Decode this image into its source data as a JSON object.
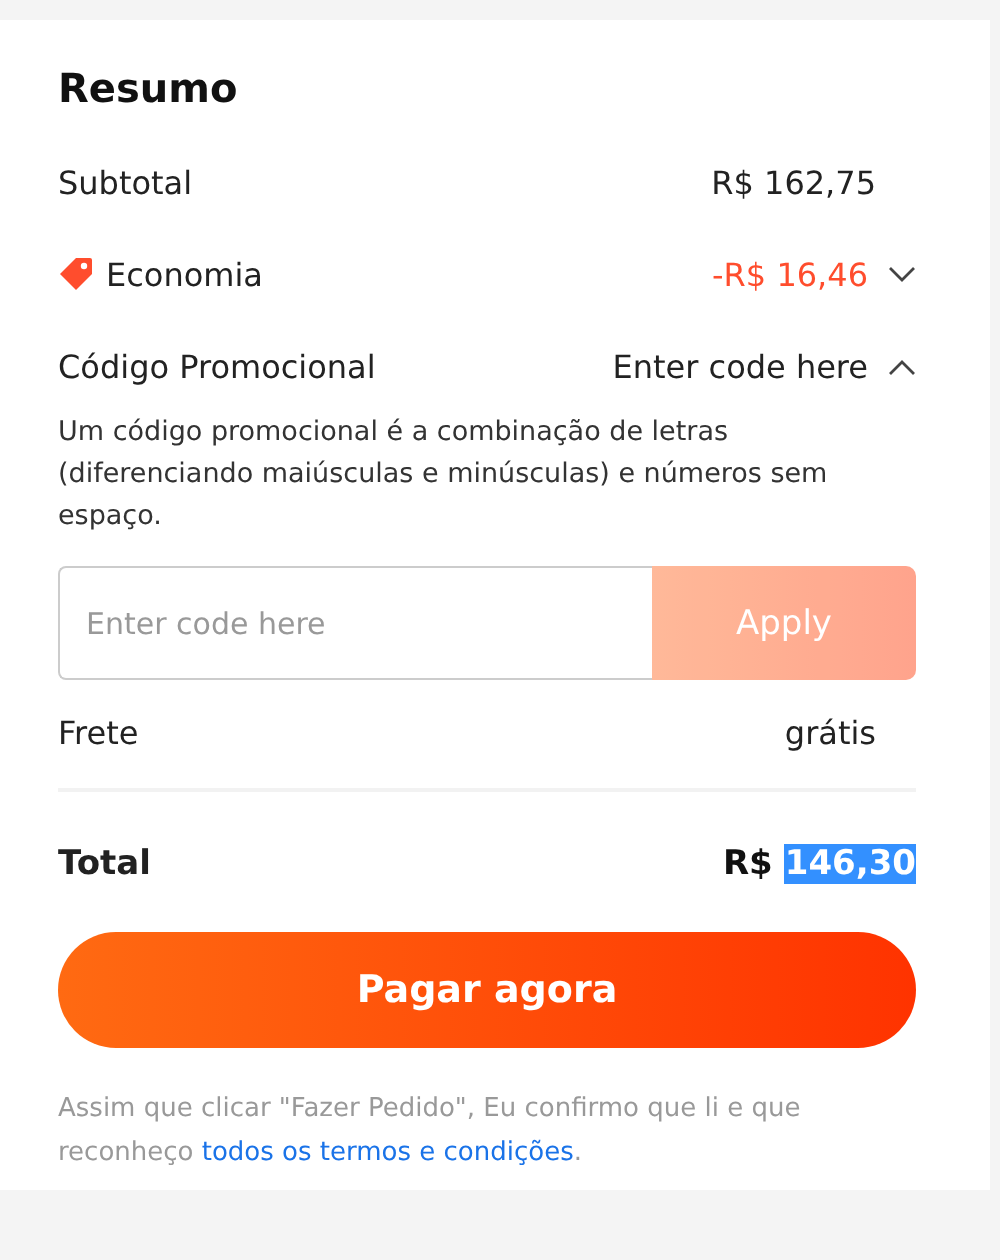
{
  "summary": {
    "title": "Resumo",
    "subtotal": {
      "label": "Subtotal",
      "value": "R$ 162,75"
    },
    "savings": {
      "label": "Economia",
      "value": "-R$ 16,46",
      "expanded": false
    },
    "promo": {
      "label": "Código Promocional",
      "value": "Enter code here",
      "expanded": true,
      "description": "Um código promocional é a combinação de letras (diferenciando maiúsculas e minúsculas) e números sem espaço.",
      "placeholder": "Enter code here",
      "button": {
        "label": "Apply",
        "disabled": true
      }
    },
    "shipping": {
      "label": "Frete",
      "value": "grátis"
    },
    "total": {
      "label": "Total",
      "currency": "R$",
      "amount": "146,30",
      "highlighted": true
    },
    "pay_button": "Pagar agora",
    "legal": {
      "text": "Assim que clicar \"Fazer Pedido\", Eu confirmo que li e que reconheço ",
      "link": "todos os termos e condições",
      "end": "."
    }
  }
}
